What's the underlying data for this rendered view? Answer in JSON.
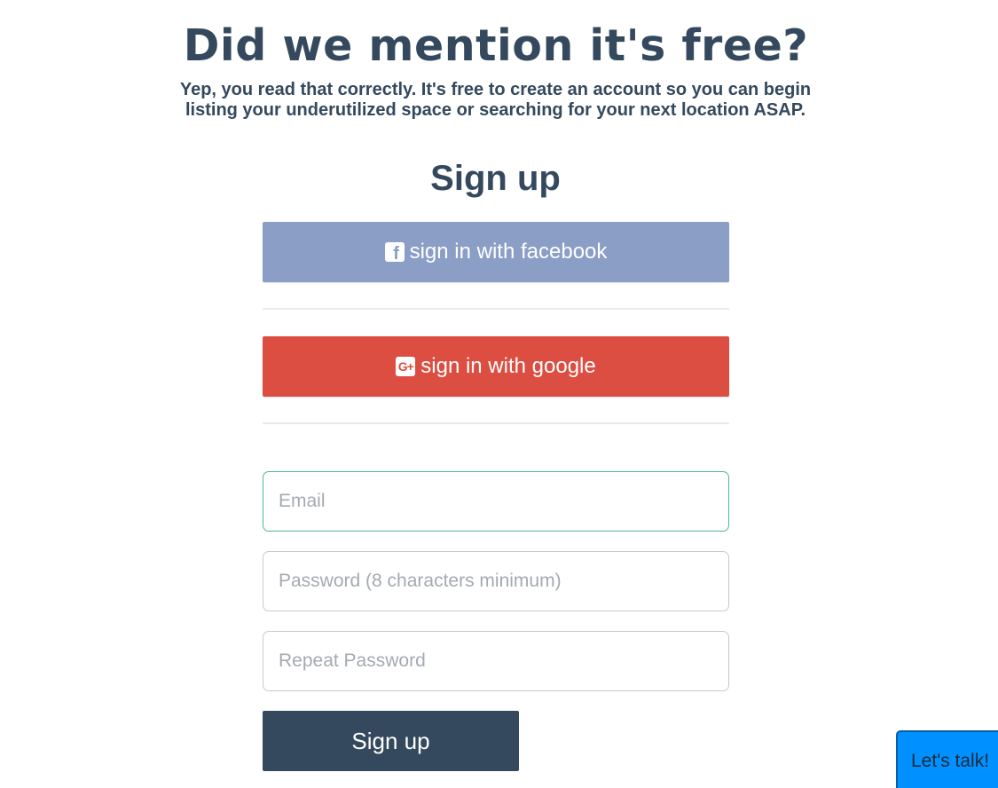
{
  "hero": {
    "title": "Did we mention it's free?",
    "subtitle_line1": "Yep, you read that correctly. It's free to create an account so you can begin",
    "subtitle_line2": "listing your underutilized space or searching for your next location ASAP."
  },
  "signup": {
    "title": "Sign up",
    "facebook_label": "sign in with facebook",
    "google_label": "sign in with google",
    "facebook_icon": "facebook-icon",
    "google_icon": "google-plus-icon",
    "email_placeholder": "Email",
    "password_placeholder": "Password (8 characters minimum)",
    "repeat_password_placeholder": "Repeat Password",
    "submit_label": "Sign up"
  },
  "chat": {
    "label": "Let's talk!"
  },
  "colors": {
    "text": "#34495e",
    "facebook": "#8b9ec6",
    "google": "#dc4e41",
    "email_focus": "#4fb98c",
    "submit": "#34495e",
    "chat": "#0090ff"
  }
}
